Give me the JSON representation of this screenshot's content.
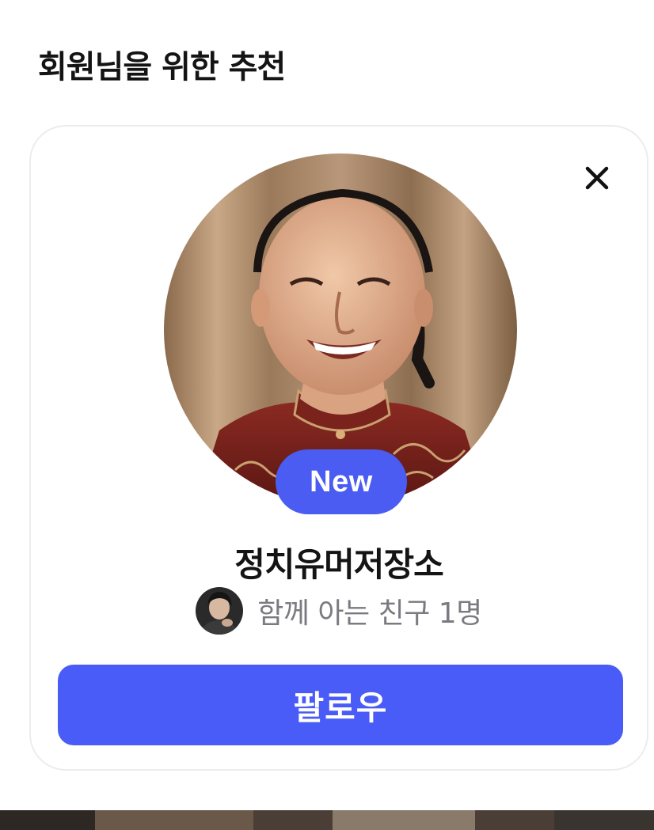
{
  "section": {
    "title": "회원님을 위한 추천"
  },
  "card": {
    "badge": "New",
    "name": "정치유머저장소",
    "mutual_friends": "함께 아는 친구 1명",
    "follow_label": "팔로우"
  },
  "colors": {
    "accent": "#4a5cf7",
    "title_text": "#141414",
    "secondary_text": "#7a7a80",
    "card_border": "#ececec"
  },
  "icons": {
    "close": "close-icon"
  }
}
